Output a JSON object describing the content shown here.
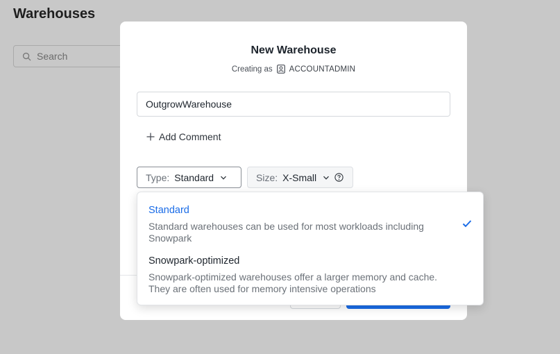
{
  "page": {
    "title": "Warehouses",
    "search_placeholder": "Search"
  },
  "modal": {
    "title": "New Warehouse",
    "creating_as_label": "Creating as",
    "role": "ACCOUNTADMIN",
    "name_value": "OutgrowWarehouse",
    "add_comment_label": "Add Comment",
    "type_label": "Type:",
    "type_value": "Standard",
    "size_label": "Size:",
    "size_value": "X-Small"
  },
  "dropdown": {
    "options": [
      {
        "title": "Standard",
        "description": "Standard warehouses can be used for most workloads including Snowpark",
        "selected": true
      },
      {
        "title": "Snowpark-optimized",
        "description": "Snowpark-optimized warehouses offer a larger memory and cache. They are often used for memory intensive operations",
        "selected": false
      }
    ]
  },
  "colors": {
    "accent": "#1a6ce7",
    "overlay": "#c8c8c8"
  },
  "icons": {
    "search": "search-icon",
    "role": "user-badge-icon",
    "plus": "plus-icon",
    "chevron": "chevron-down-icon",
    "help": "help-circle-icon",
    "check": "checkmark-icon"
  }
}
